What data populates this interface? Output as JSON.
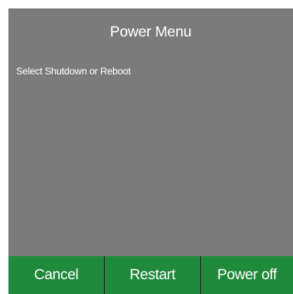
{
  "dialog": {
    "title": "Power Menu",
    "message": "Select Shutdown or Reboot"
  },
  "buttons": {
    "cancel_label": "Cancel",
    "restart_label": "Restart",
    "power_off_label": "Power off"
  },
  "colors": {
    "dialog_background": "#7b7b7b",
    "button_background": "#1f8a3b",
    "text": "#ffffff",
    "button_divider": "#111111"
  }
}
